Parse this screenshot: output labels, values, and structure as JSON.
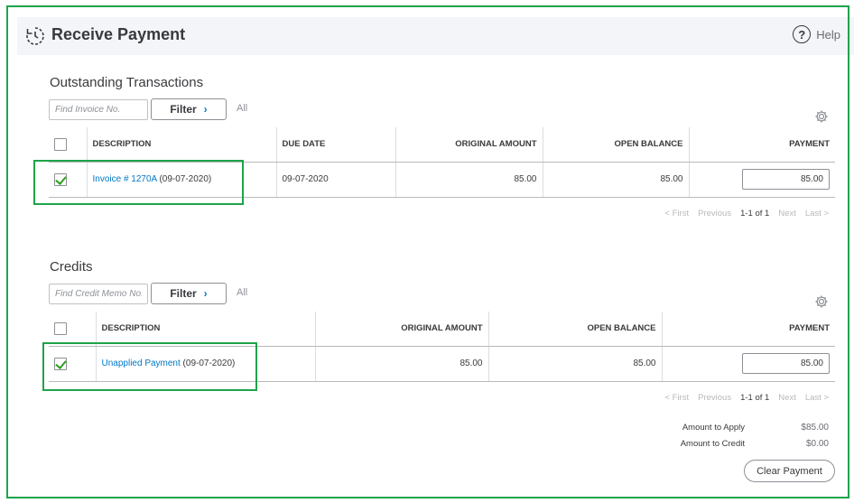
{
  "header": {
    "title": "Receive Payment",
    "help_label": "Help",
    "help_glyph": "?"
  },
  "outstanding": {
    "title": "Outstanding Transactions",
    "search_placeholder": "Find Invoice No.",
    "filter_label": "Filter",
    "filter_chevron": "›",
    "all_label": "All",
    "columns": [
      "DESCRIPTION",
      "DUE DATE",
      "ORIGINAL AMOUNT",
      "OPEN BALANCE",
      "PAYMENT"
    ],
    "rows": [
      {
        "checked": true,
        "link_text": "Invoice # 1270A",
        "date_text": " (09-07-2020)",
        "due_date": "09-07-2020",
        "original_amount": "85.00",
        "open_balance": "85.00",
        "payment": "85.00"
      }
    ],
    "pager": {
      "first": "< First",
      "previous": "Previous",
      "current": "1-1 of 1",
      "next": "Next",
      "last": "Last >"
    }
  },
  "credits": {
    "title": "Credits",
    "search_placeholder": "Find Credit Memo No.",
    "filter_label": "Filter",
    "filter_chevron": "›",
    "all_label": "All",
    "columns": [
      "DESCRIPTION",
      "ORIGINAL AMOUNT",
      "OPEN BALANCE",
      "PAYMENT"
    ],
    "rows": [
      {
        "checked": true,
        "link_text": "Unapplied Payment",
        "date_text": " (09-07-2020)",
        "original_amount": "85.00",
        "open_balance": "85.00",
        "payment": "85.00"
      }
    ],
    "pager": {
      "first": "< First",
      "previous": "Previous",
      "current": "1-1 of 1",
      "next": "Next",
      "last": "Last >"
    }
  },
  "totals": {
    "amount_to_apply_label": "Amount to Apply",
    "amount_to_apply_value": "$85.00",
    "amount_to_credit_label": "Amount to Credit",
    "amount_to_credit_value": "$0.00"
  },
  "clear_payment_label": "Clear Payment",
  "colors": {
    "highlight": "#1fa34a",
    "link": "#0077c5",
    "check": "#2ca01c"
  },
  "icons": {
    "logo": "receive-payment-icon",
    "help": "help-icon",
    "gear": "gear-icon",
    "check": "checkmark-icon"
  }
}
